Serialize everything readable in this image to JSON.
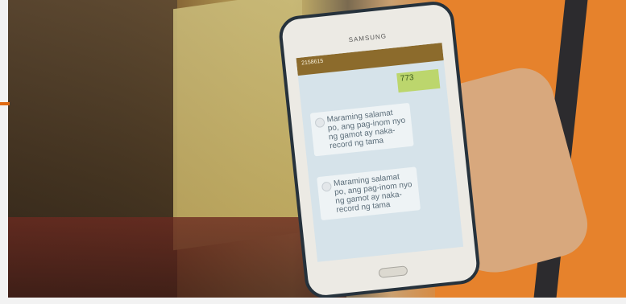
{
  "phone": {
    "brand": "SAMSUNG",
    "app_bar_title": "2158615",
    "sent_message": "773",
    "messages": [
      {
        "text": "Maraming salamat po, ang pag-inom nyo ng gamot ay naka-record ng tama"
      },
      {
        "text": "Maraming salamat po, ang pag-inom nyo ng gamot ay naka-record ng tama"
      }
    ]
  }
}
